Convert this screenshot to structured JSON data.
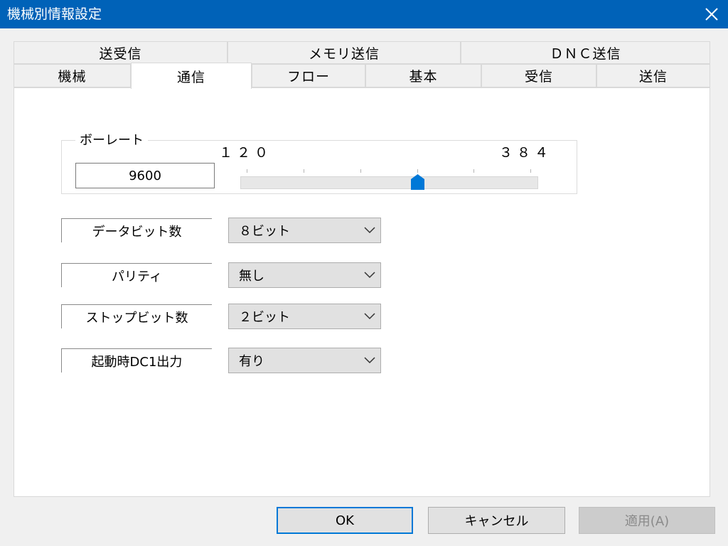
{
  "window": {
    "title": "機械別情報設定",
    "close_icon": "close-icon"
  },
  "tabs": {
    "row_top": [
      {
        "label": "送受信"
      },
      {
        "label": "メモリ送信"
      },
      {
        "label": "ＤＮＣ送信"
      }
    ],
    "row_bottom": [
      {
        "label": "機械"
      },
      {
        "label": "通信",
        "active": true
      },
      {
        "label": "フロー"
      },
      {
        "label": "基本"
      },
      {
        "label": "受信"
      },
      {
        "label": "送信"
      }
    ]
  },
  "baud": {
    "group_title": "ボーレート",
    "value": "9600",
    "scale_min": "１２０",
    "scale_max": "３８４",
    "slider_position": 0.6,
    "accent_color": "#0078d7"
  },
  "fields": [
    {
      "label": "データビット数",
      "value": "８ビット"
    },
    {
      "label": "パリティ",
      "value": "無し"
    },
    {
      "label": "ストップビット数",
      "value": "２ビット"
    },
    {
      "label": "起動時DC1出力",
      "value": "有り"
    }
  ],
  "buttons": {
    "ok": "OK",
    "cancel": "キャンセル",
    "apply": "適用(A)"
  }
}
